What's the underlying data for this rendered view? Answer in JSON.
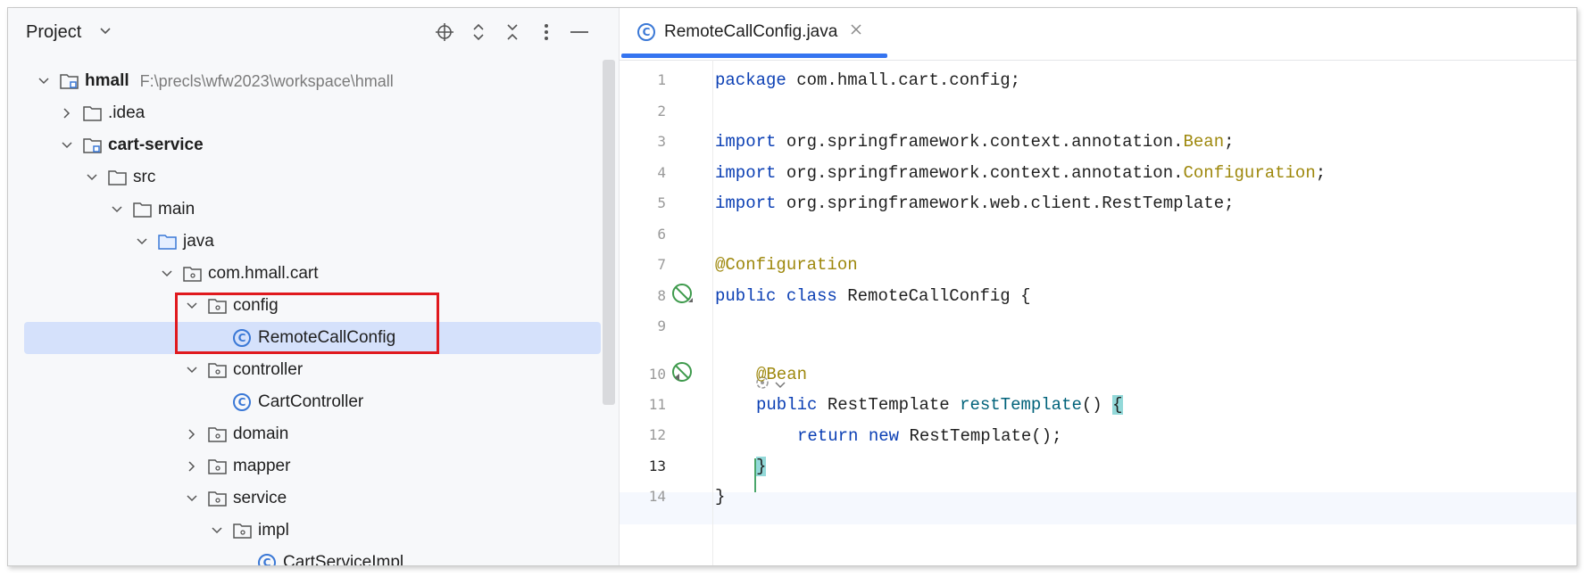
{
  "project_panel": {
    "title": "Project",
    "tree": [
      {
        "label": "hmall",
        "path": "F:\\precls\\wfw2023\\workspace\\hmall",
        "bold": true
      },
      {
        "label": ".idea"
      },
      {
        "label": "cart-service",
        "bold": true
      },
      {
        "label": "src"
      },
      {
        "label": "main"
      },
      {
        "label": "java"
      },
      {
        "label": "com.hmall.cart"
      },
      {
        "label": "config"
      },
      {
        "label": "RemoteCallConfig",
        "selected": true
      },
      {
        "label": "controller"
      },
      {
        "label": "CartController"
      },
      {
        "label": "domain"
      },
      {
        "label": "mapper"
      },
      {
        "label": "service"
      },
      {
        "label": "impl"
      },
      {
        "label": "CartServiceImpl"
      }
    ]
  },
  "editor": {
    "tab": {
      "label": "RemoteCallConfig.java",
      "icon_letter": "C"
    },
    "line_numbers": [
      "1",
      "2",
      "3",
      "4",
      "5",
      "6",
      "7",
      "8",
      "9",
      "10",
      "11",
      "12",
      "13",
      "14"
    ],
    "code": {
      "l1_kw": "package",
      "l1_rest": " com.hmall.cart.config;",
      "import_kw": "import",
      "l3_rest": " org.springframework.context.annotation.",
      "l3_cls": "Bean",
      "l3_end": ";",
      "l4_rest": " org.springframework.context.annotation.",
      "l4_cls": "Configuration",
      "l4_end": ";",
      "l5_rest": " org.springframework.web.client.RestTemplate;",
      "l7": "@Configuration",
      "public_kw": "public",
      "class_kw": "class",
      "l8_rest": " RemoteCallConfig {",
      "l10": "@Bean",
      "l11_type": " RestTemplate ",
      "l11_fn": "restTemplate",
      "l11_parens": "() ",
      "l11_brace": "{",
      "return_kw": "return",
      "new_kw": "new",
      "l12_rest": " RestTemplate();",
      "l13_brace": "}",
      "l14": "}"
    }
  },
  "colors": {
    "accent": "#3574f0",
    "highlight_box": "#e0191e",
    "selection": "#d5e1fb",
    "keyword": "#0b3fb4",
    "annotation": "#9e880d"
  }
}
